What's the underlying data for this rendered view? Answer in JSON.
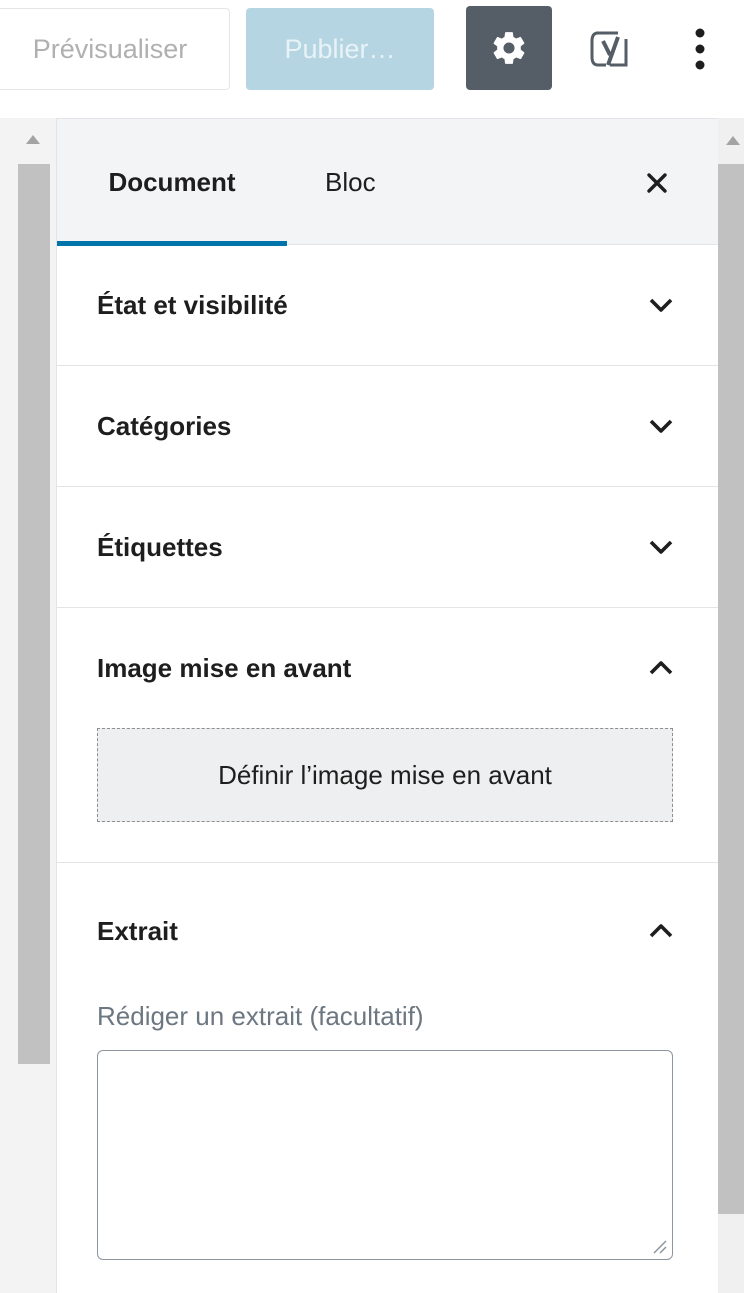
{
  "toolbar": {
    "preview_label": "Prévisualiser",
    "publish_label": "Publier…",
    "settings_icon": "gear-icon",
    "yoast_icon": "yoast-icon",
    "more_icon": "more-vertical-icon",
    "colors": {
      "settings_bg": "#555d66",
      "publish_bg": "#b4d5e1"
    }
  },
  "sidebar": {
    "tabs": [
      {
        "label": "Document",
        "active": true
      },
      {
        "label": "Bloc",
        "active": false
      }
    ],
    "close_icon": "close-icon",
    "accent_color": "#0073aa",
    "panels": [
      {
        "title": "État et visibilité",
        "expanded": false
      },
      {
        "title": "Catégories",
        "expanded": false
      },
      {
        "title": "Étiquettes",
        "expanded": false
      },
      {
        "title": "Image mise en avant",
        "expanded": true,
        "button_label": "Définir l’image mise en avant"
      },
      {
        "title": "Extrait",
        "expanded": true,
        "field_label": "Rédiger un extrait (facultatif)",
        "field_value": ""
      }
    ]
  }
}
